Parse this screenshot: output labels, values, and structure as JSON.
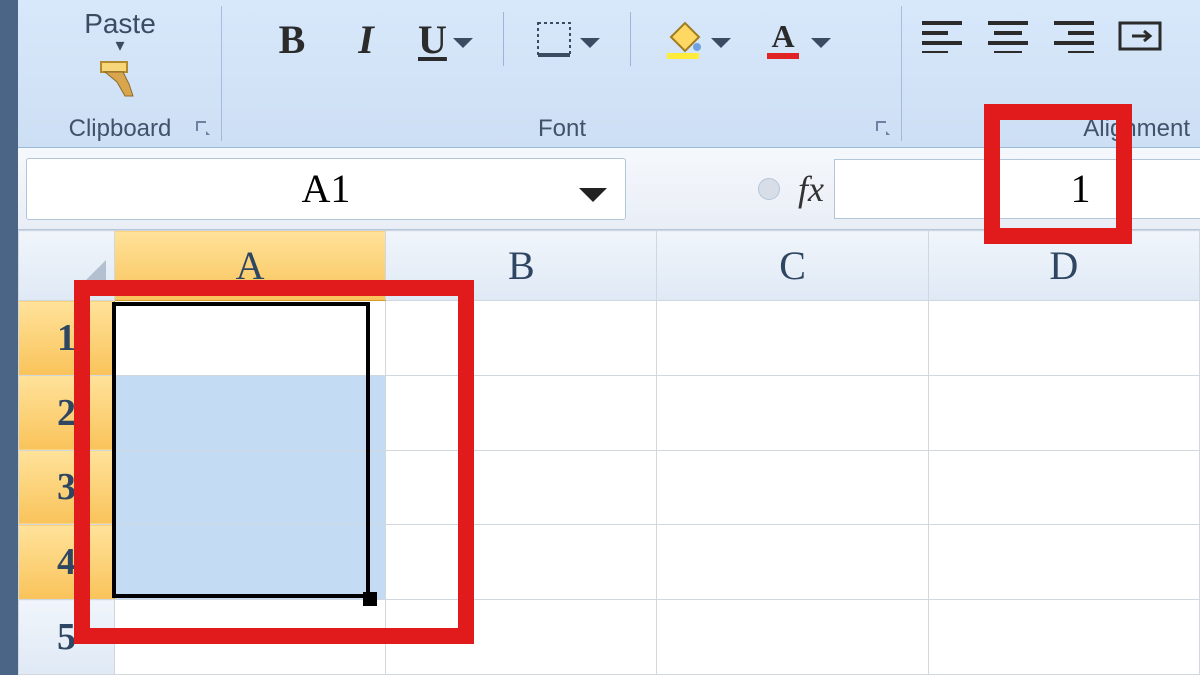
{
  "ribbon": {
    "clipboard": {
      "paste_label": "Paste",
      "group_label": "Clipboard"
    },
    "font": {
      "bold_label": "B",
      "italic_label": "I",
      "underline_label": "U",
      "group_label": "Font"
    },
    "alignment": {
      "group_label": "Alignment"
    }
  },
  "formula_bar": {
    "name_box_value": "A1",
    "fx_label": "fx",
    "formula_value": "1"
  },
  "grid": {
    "column_headers": [
      "A",
      "B",
      "C",
      "D"
    ],
    "row_headers": [
      "1",
      "2",
      "3",
      "4",
      "5"
    ],
    "active_column_index": 0,
    "active_row_indices": [
      0,
      1,
      2,
      3
    ],
    "active_primary_row_index": 0,
    "cells": {}
  },
  "colors": {
    "selection_header": "#f9c35a",
    "selection_fill": "#c3dcf3",
    "annotation": "#e11b1b",
    "fill_swatch": "#ffeb3b",
    "font_color_swatch": "#e22323"
  }
}
